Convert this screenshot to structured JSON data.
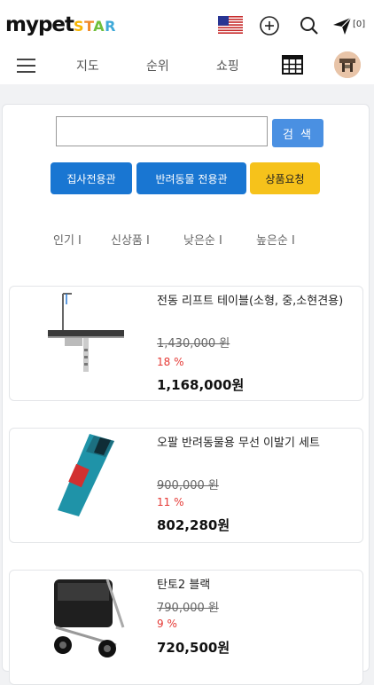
{
  "header": {
    "logo_main": "mypet",
    "logo_star": "STAR",
    "send_count": "[0]"
  },
  "icons": {
    "flag": "us-flag-icon",
    "add": "plus-circle-icon",
    "search": "search-icon",
    "send": "paper-plane-icon",
    "menu": "hamburger-menu-icon",
    "table": "table-grid-icon"
  },
  "nav": {
    "items": [
      "지도",
      "순위",
      "쇼핑"
    ]
  },
  "search": {
    "value": "",
    "button_label": "검 색"
  },
  "buttons": {
    "butler": "집사전용관",
    "pet": "반려동물 전용관",
    "request": "상품요청"
  },
  "sort": {
    "items": [
      "인기 I",
      "신상품 I",
      "낮은순 I",
      "높은순 I"
    ]
  },
  "products": [
    {
      "name": "전동 리프트 테이블(소형, 중,소현견용)",
      "original_price": "1,430,000 원",
      "discount": "18 %",
      "price": "1,168,000원"
    },
    {
      "name": "오팔 반려동물용 무선 이발기 세트",
      "original_price": "900,000 원",
      "discount": "11 %",
      "price": "802,280원"
    },
    {
      "name": "탄토2 블랙",
      "original_price": "790,000 원",
      "discount": "9 %",
      "price": "720,500원"
    }
  ],
  "colors": {
    "accent_blue": "#1976d2",
    "search_blue": "#4a90e2",
    "request_yellow": "#f6c21b",
    "discount_red": "#e53935"
  }
}
